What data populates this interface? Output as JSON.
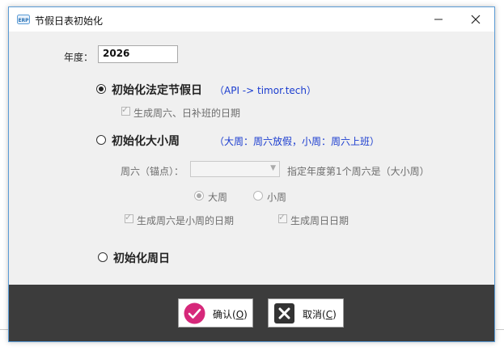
{
  "window": {
    "title": "节假日表初始化",
    "app_icon": "erp-icon"
  },
  "year": {
    "label": "年度：",
    "value": "2026"
  },
  "options": {
    "legal_holiday": {
      "label": "初始化法定节假日",
      "hint": "（API -> timor.tech）",
      "checked": true,
      "sub_checkbox_label": "生成周六、日补班的日期"
    },
    "big_small_week": {
      "label": "初始化大小周",
      "hint": "（大周：周六放假，小周：周六上班）",
      "checked": false,
      "anchor_label": "周六（锚点）：",
      "anchor_select_value": "",
      "anchor_desc": "指定年度第1个周六是（大小周）",
      "radio_big": "大周",
      "radio_small": "小周",
      "check_small_week_sat": "生成周六是小周的日期",
      "check_sunday": "生成周日日期"
    },
    "weekend": {
      "label": "初始化周日",
      "checked": false
    }
  },
  "buttons": {
    "ok_label": "确认(",
    "ok_hotkey": "O",
    "ok_close": ")",
    "cancel_label": "取消(",
    "cancel_hotkey": "C",
    "cancel_close": ")"
  },
  "colors": {
    "accent_blue_text": "#1a3ccf",
    "ok_icon": "#d6287a",
    "cancel_icon": "#333333",
    "footer": "#3c3c3c"
  }
}
